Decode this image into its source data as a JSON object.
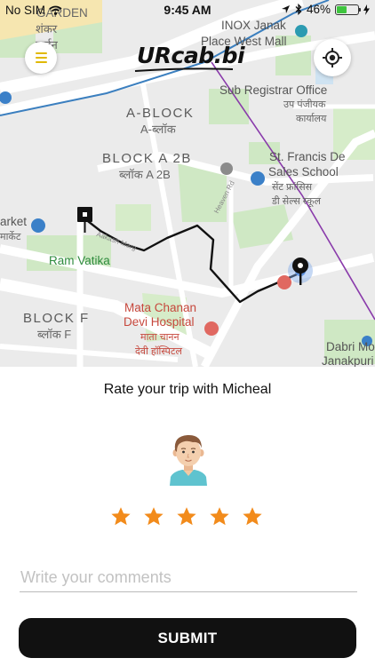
{
  "status_bar": {
    "carrier": "No SIM",
    "time": "9:45 AM",
    "battery": "46%",
    "battery_level": 0.46
  },
  "header": {
    "logo": "URcab.bi"
  },
  "map": {
    "labels": {
      "shankar_hi": "शंकर",
      "shankar_en": "GARDEN",
      "garden_hi": "गार्डन",
      "inox": "INOX Janak",
      "inox2": "Place West Mall",
      "sub_registrar": "Sub Registrar Office",
      "sub_registrar_hi1": "उप पंजीयक",
      "sub_registrar_hi2": "कार्यालय",
      "a_block": "A-BLOCK",
      "a_block_hi": "A-ब्लॉक",
      "block_a2b": "BLOCK A 2B",
      "block_a2b_hi": "ब्लॉक A 2B",
      "st_francis1": "St. Francis De",
      "st_francis2": "Sales School",
      "st_francis_hi1": "सेंट फ्रांसिस",
      "st_francis_hi2": "डी सेल्स स्कूल",
      "market": "arket",
      "market_hi": "मार्केट",
      "ram_vatika": "Ram Vatika",
      "heaven_rd": "Heaven Rd",
      "aakash_marg": "Aakash Marg",
      "mata1": "Mata Chanan",
      "mata2": "Devi Hospital",
      "mata_hi1": "माता चानन",
      "mata_hi2": "देवी हॉस्पिटल",
      "block_f": "BLOCK F",
      "block_f_hi": "ब्लॉक F",
      "dabri": "Dabri Mo",
      "janakpuri": "Janakpuri So"
    }
  },
  "rating": {
    "title": "Rate your trip with Micheal",
    "stars_selected": 5,
    "stars_total": 5,
    "star_color": "#f28b1b"
  },
  "comment": {
    "placeholder": "Write your comments",
    "value": ""
  },
  "submit": {
    "label": "SUBMIT"
  },
  "colors": {
    "accent_menu": "#e0b800",
    "route": "#111111",
    "button": "#111111"
  }
}
